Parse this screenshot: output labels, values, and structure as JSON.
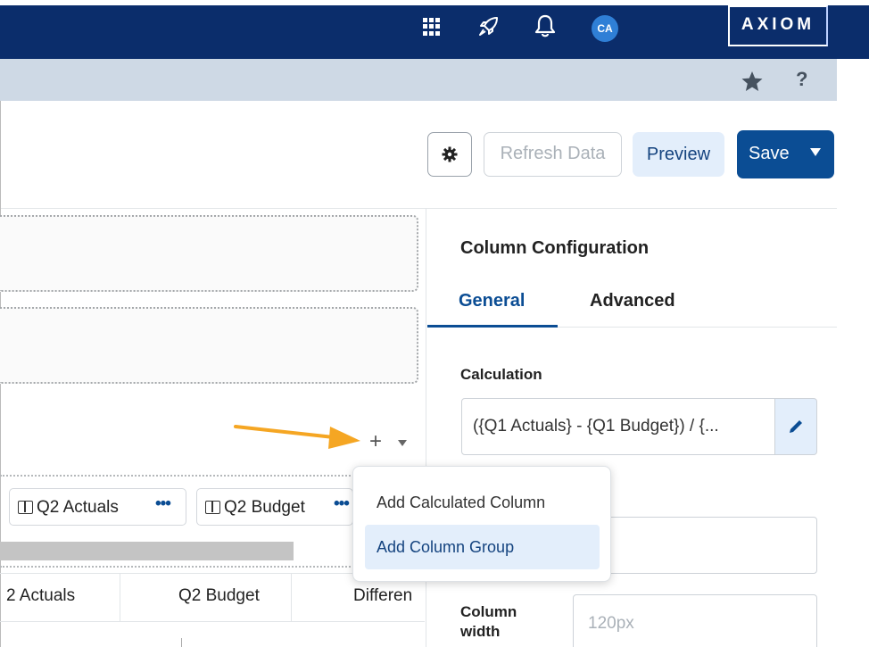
{
  "header": {
    "logo": "AXIOM",
    "avatar_initials": "CA",
    "icons": [
      "apps-grid-icon",
      "rocket-icon",
      "bell-icon"
    ],
    "brand_color": "#0b2d6b"
  },
  "subbar": {
    "icons": [
      "star-icon",
      "help-icon"
    ],
    "help_label": "?"
  },
  "toolbar": {
    "settings_icon": "gear-icon",
    "refresh_label": "Refresh Data",
    "preview_label": "Preview",
    "save_label": "Save"
  },
  "designer": {
    "add_symbol": "+",
    "column_chips": [
      {
        "label": "Q2 Actuals",
        "menu": "•••"
      },
      {
        "label": "Q2 Budget",
        "menu": "•••"
      }
    ],
    "table_headers": [
      "2 Actuals",
      "Q2 Budget",
      "Differen"
    ]
  },
  "add_menu": {
    "items": [
      {
        "label": "Add Calculated Column",
        "highlighted": false
      },
      {
        "label": "Add Column Group",
        "highlighted": true
      }
    ]
  },
  "panel": {
    "title": "Column Configuration",
    "tabs": [
      {
        "label": "General",
        "active": true
      },
      {
        "label": "Advanced",
        "active": false
      }
    ],
    "calculation_label": "Calculation",
    "calculation_value": "({Q1 Actuals} - {Q1 Budget}) / {...",
    "column_width_label": "Column width",
    "column_width_placeholder": "120px"
  }
}
